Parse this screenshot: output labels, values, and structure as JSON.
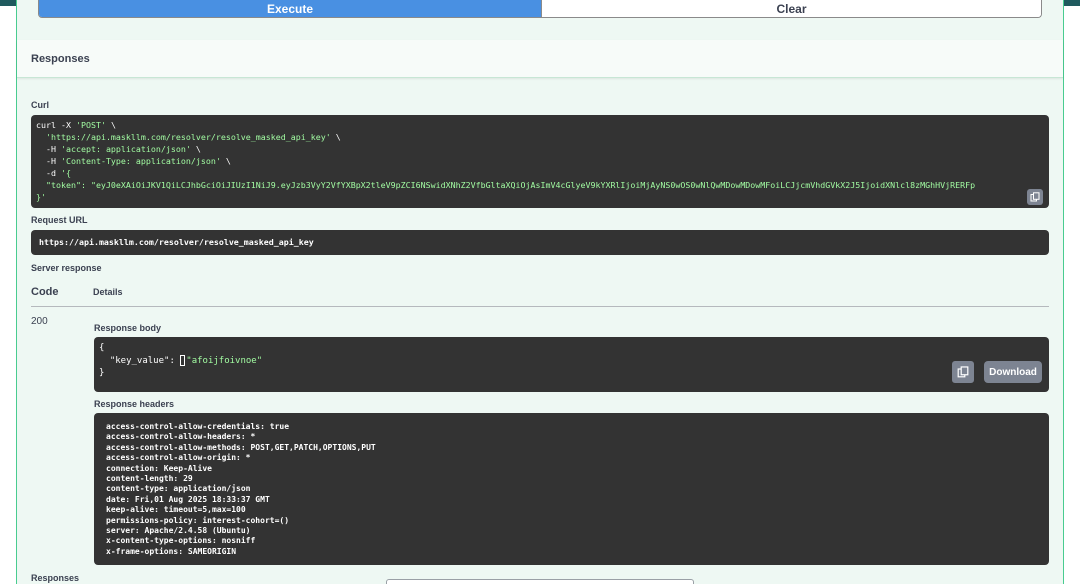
{
  "execute_button": {
    "label": "Execute"
  },
  "clear_button": {
    "label": "Clear"
  },
  "responses_section": {
    "title": "Responses"
  },
  "curl": {
    "label": "Curl",
    "lines": [
      {
        "plain": "curl -X ",
        "str": "'POST'",
        "tail": " \\"
      },
      {
        "plain": "  ",
        "str": "'https://api.maskllm.com/resolver/resolve_masked_api_key'",
        "tail": " \\"
      },
      {
        "plain": "  -H ",
        "str": "'accept: application/json'",
        "tail": " \\"
      },
      {
        "plain": "  -H ",
        "str": "'Content-Type: application/json'",
        "tail": " \\"
      },
      {
        "plain": "  -d ",
        "str": "'{",
        "tail": ""
      },
      {
        "plain": "",
        "str": "  \"token\": \"eyJ0eXAiOiJKV1QiLCJhbGciOiJIUzI1NiJ9.eyJzb3VyY2VfYXBpX2tleV9pZCI6NSwidXNhZ2VfbGltaXQiOjAsImV4cGlyeV9kYXRlIjoiMjAyNS0wOS0wNlQwMDowMDowMFoiLCJjcmVhdGVkX2J5IjoidXNlcl8zMGhHVjRERFp",
        "tail": ""
      },
      {
        "plain": "",
        "str": "}'",
        "tail": ""
      }
    ]
  },
  "request_url": {
    "label": "Request URL",
    "value": "https://api.maskllm.com/resolver/resolve_masked_api_key"
  },
  "server_response": {
    "label": "Server response",
    "code_header": "Code",
    "details_header": "Details",
    "status_code": "200",
    "response_body_label": "Response body",
    "response_body": {
      "open": "{",
      "key_line_prefix": "  \"key_value\": ",
      "key_line_value": "\"afoijfoivnoe\"",
      "close": "}"
    },
    "download_label": "Download",
    "response_headers_label": "Response headers",
    "headers": [
      "access-control-allow-credentials: true",
      "access-control-allow-headers: *",
      "access-control-allow-methods: POST,GET,PATCH,OPTIONS,PUT",
      "access-control-allow-origin: *",
      "connection: Keep-Alive",
      "content-length: 29",
      "content-type: application/json",
      "date: Fri,01 Aug 2025 18:33:37 GMT",
      "keep-alive: timeout=5,max=100",
      "permissions-policy: interest-cohort=()",
      "server: Apache/2.4.58 (Ubuntu)",
      "x-content-type-options: nosniff",
      "x-frame-options: SAMEORIGIN"
    ]
  },
  "responses_footer": {
    "label": "Responses"
  }
}
